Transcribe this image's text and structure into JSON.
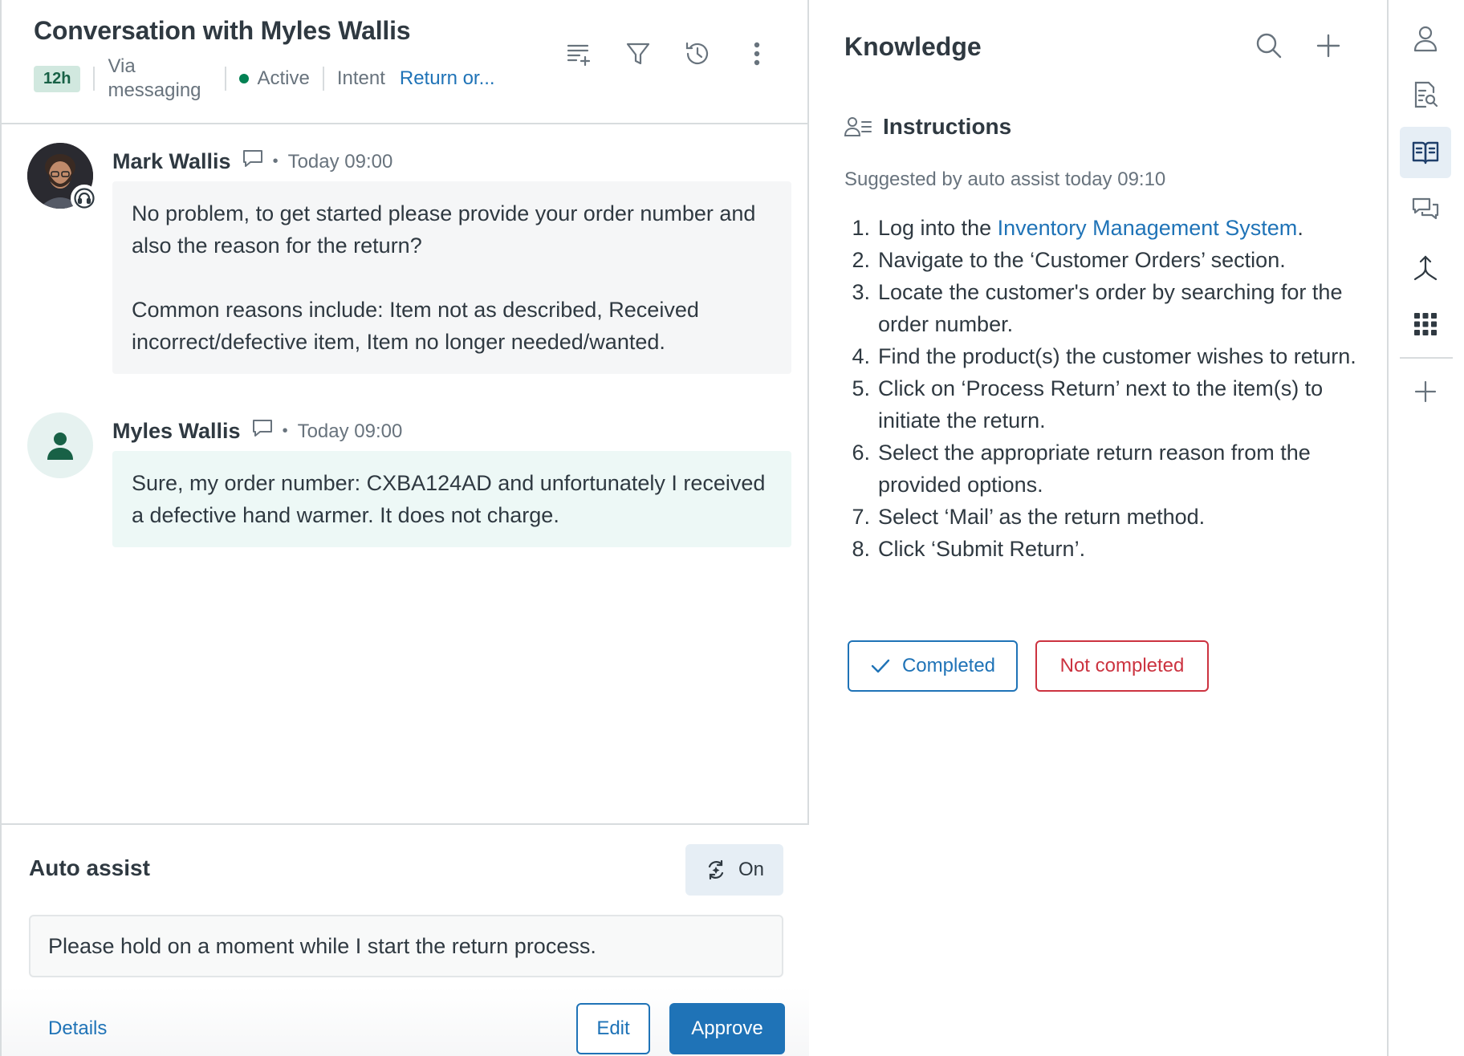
{
  "conversation": {
    "title": "Conversation with Myles Wallis",
    "time_badge": "12h",
    "channel": "Via messaging",
    "status": "Active",
    "intent_label": "Intent",
    "intent_value": "Return or...",
    "messages": [
      {
        "author": "Mark Wallis",
        "time": "Today 09:00",
        "role": "agent",
        "paragraphs": [
          "No problem, to get started please provide your order number and also the reason for the return?",
          "Common reasons include: Item not as described, Received incorrect/defective item, Item no longer needed/wanted."
        ]
      },
      {
        "author": "Myles Wallis",
        "time": "Today 09:00",
        "role": "customer",
        "paragraphs": [
          "Sure, my order number: CXBA124AD and unfortunately I received a defective hand warmer. It does not charge."
        ]
      }
    ]
  },
  "auto_assist": {
    "title": "Auto assist",
    "toggle_label": "On",
    "suggestion": "Please hold on a moment while I start the return process.",
    "details_label": "Details",
    "edit_label": "Edit",
    "approve_label": "Approve"
  },
  "knowledge": {
    "title": "Knowledge",
    "section_title": "Instructions",
    "suggested_by": "Suggested by auto assist today 09:10",
    "steps": [
      {
        "num": "1.",
        "pre": "Log into the ",
        "link": "Inventory Management System",
        "post": "."
      },
      {
        "num": "2.",
        "pre": "Navigate to the ‘Customer Orders’ section.",
        "link": "",
        "post": ""
      },
      {
        "num": "3.",
        "pre": "Locate the customer's order by searching for the order number.",
        "link": "",
        "post": ""
      },
      {
        "num": "4.",
        "pre": "Find the product(s) the customer wishes to return.",
        "link": "",
        "post": ""
      },
      {
        "num": "5.",
        "pre": "Click on ‘Process Return’ next to the item(s) to initiate the return.",
        "link": "",
        "post": ""
      },
      {
        "num": "6.",
        "pre": "Select the appropriate return reason from the provided options.",
        "link": "",
        "post": ""
      },
      {
        "num": "7.",
        "pre": "Select ‘Mail’ as the return method.",
        "link": "",
        "post": ""
      },
      {
        "num": "8.",
        "pre": "Click ‘Submit Return’.",
        "link": "",
        "post": ""
      }
    ],
    "completed_label": "Completed",
    "not_completed_label": "Not completed"
  },
  "colors": {
    "accent": "#1f73b7",
    "danger": "#cc3340",
    "active_dot": "#038153",
    "time_badge_bg": "#d1e8df"
  },
  "icons": {
    "header": [
      "add-to-list-icon",
      "filter-icon",
      "history-icon",
      "overflow-menu-icon"
    ],
    "knowledge": [
      "search-icon",
      "plus-icon",
      "instructions-icon"
    ],
    "rail": [
      "user-icon",
      "document-search-icon",
      "book-icon",
      "chat-bubbles-icon",
      "merge-icon",
      "apps-grid-icon",
      "plus-icon"
    ]
  }
}
